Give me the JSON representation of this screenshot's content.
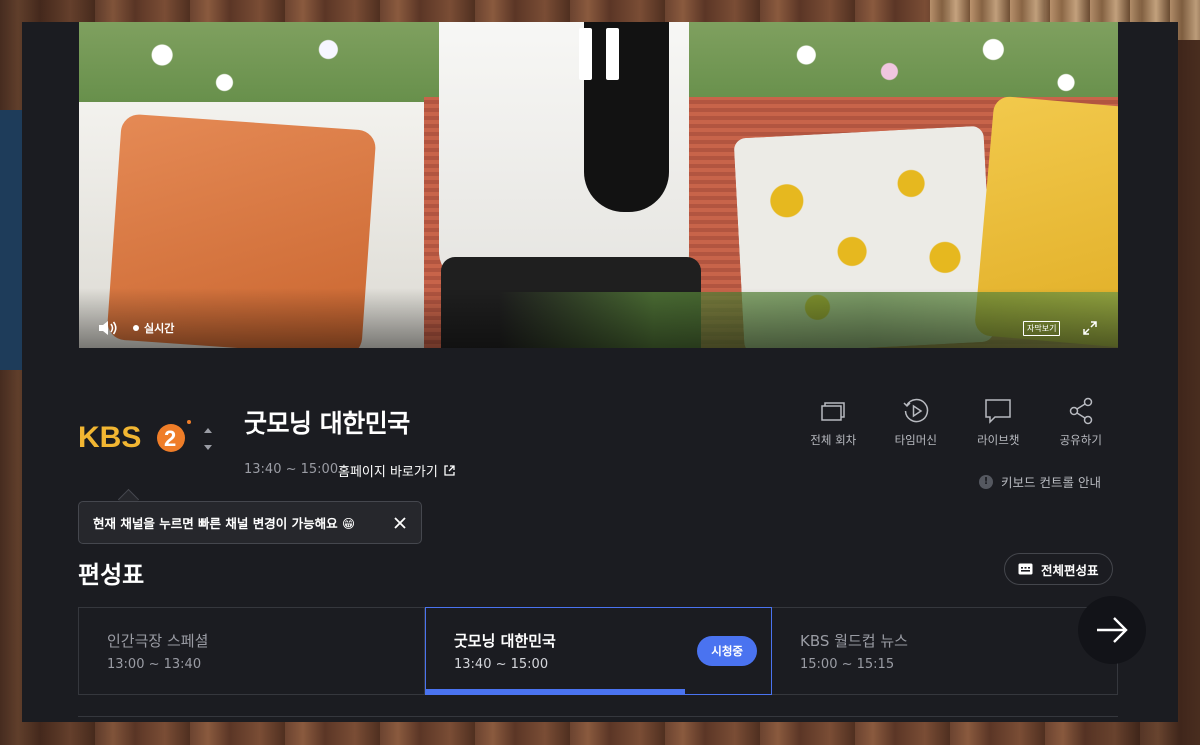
{
  "player": {
    "live_label": "실시간",
    "subtitle_label": "자막보기"
  },
  "channel": {
    "logo_text": "KBS",
    "logo_number": "2"
  },
  "program": {
    "title": "굿모닝 대한민국",
    "time": "13:40 ~ 15:00",
    "homepage_link": "홈페이지 바로가기"
  },
  "actions": [
    {
      "label": "전체 회차",
      "icon": "episodes-icon"
    },
    {
      "label": "타임머신",
      "icon": "timemachine-icon"
    },
    {
      "label": "라이브챗",
      "icon": "chat-icon"
    },
    {
      "label": "공유하기",
      "icon": "share-icon"
    }
  ],
  "keyboard_guide": "키보드 컨트롤 안내",
  "tooltip": {
    "text": "현재 채널을 누르면 빠른 채널 변경이 가능해요 😁"
  },
  "schedule": {
    "title": "편성표",
    "full_button": "전체편성표",
    "items": [
      {
        "title": "인간극장 스페셜",
        "time": "13:00 ~ 13:40"
      },
      {
        "title": "굿모닝 대한민국",
        "time": "13:40 ~ 15:00",
        "badge": "시청중",
        "progress": 0.75
      },
      {
        "title": "KBS 월드컵 뉴스",
        "time": "15:00 ~ 15:15"
      }
    ]
  },
  "colors": {
    "accent": "#4a73f0",
    "logo_yellow": "#f2b632",
    "logo_orange": "#ef7d28"
  }
}
